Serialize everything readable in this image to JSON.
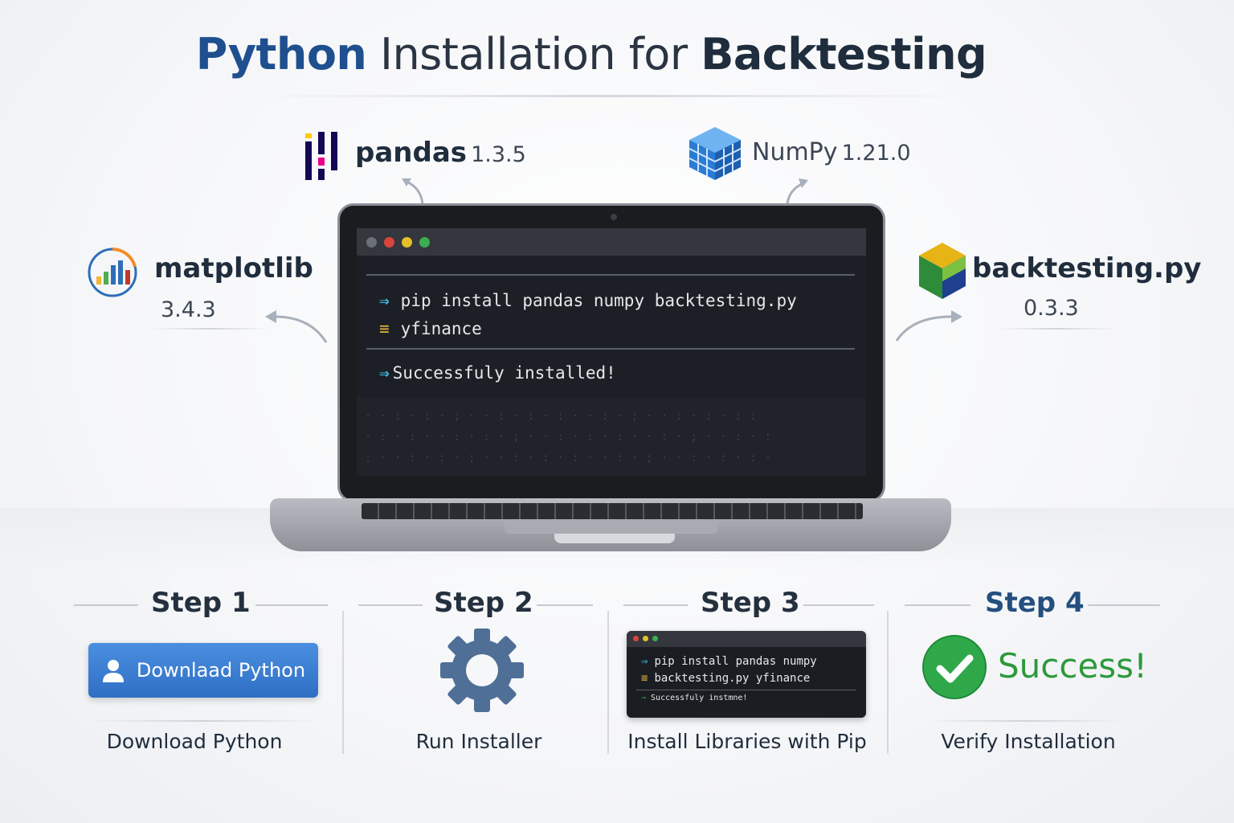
{
  "title": {
    "part1": "Python",
    "part2": " Installation for ",
    "part3": "Backtesting"
  },
  "libraries": {
    "pandas": {
      "name": "pandas",
      "version": "1.3.5",
      "icon": "pandas-logo-icon"
    },
    "numpy": {
      "name": "NumPy",
      "version": "1.21.0",
      "icon": "numpy-cube-icon"
    },
    "matplotlib": {
      "name": "matplotlib",
      "version": "3.4.3",
      "icon": "matplotlib-chart-icon"
    },
    "backtesting": {
      "name": "backtesting.py",
      "version": "0.3.3",
      "icon": "backtesting-cube-icon"
    }
  },
  "terminal": {
    "line1": "pip install pandas numpy backtesting.py",
    "line2": "yfinance",
    "line3": "Successfuly installed!",
    "prompt_glyph": "⇒",
    "menu_glyph": "≡"
  },
  "steps": [
    {
      "heading": "Step 1",
      "caption": "Download Python",
      "button_label": "Downlaad Python"
    },
    {
      "heading": "Step 2",
      "caption": "Run Installer"
    },
    {
      "heading": "Step 3",
      "caption": "Install Libraries with Pip",
      "mini_line1": "pip install pandas numpy",
      "mini_line2": "backtesting.py yfinance",
      "mini_line3": "Successfuly instmne!"
    },
    {
      "heading": "Step 4",
      "caption": "Verify Installation",
      "success": "Success!"
    }
  ],
  "colors": {
    "title_blue": "#1e4f8f",
    "button_blue": "#3b7fd4",
    "success_green": "#2c9a3a",
    "prompt_cyan": "#3fc1e6"
  }
}
